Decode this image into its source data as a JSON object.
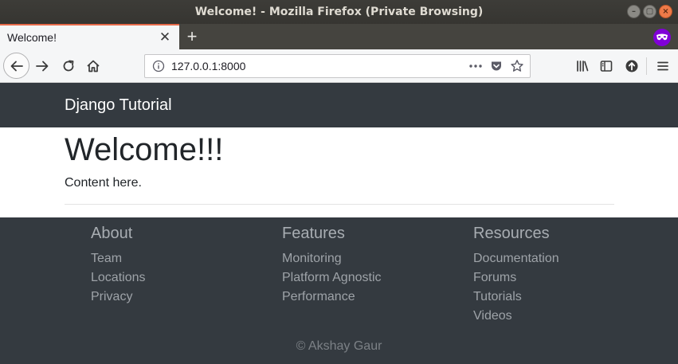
{
  "window": {
    "title": "Welcome! - Mozilla Firefox (Private Browsing)"
  },
  "tabs": [
    {
      "label": "Welcome!",
      "active": true
    }
  ],
  "toolbar": {
    "url": "127.0.0.1:8000"
  },
  "page": {
    "brand": "Django Tutorial",
    "heading": "Welcome!!!",
    "content": "Content here.",
    "footer": {
      "columns": [
        {
          "heading": "About",
          "links": [
            "Team",
            "Locations",
            "Privacy"
          ]
        },
        {
          "heading": "Features",
          "links": [
            "Monitoring",
            "Platform Agnostic",
            "Performance"
          ]
        },
        {
          "heading": "Resources",
          "links": [
            "Documentation",
            "Forums",
            "Tutorials",
            "Videos"
          ]
        }
      ],
      "copyright": "© Akshay Gaur"
    }
  },
  "icons": {
    "window_minimize": "minimize-icon",
    "window_maximize": "maximize-icon",
    "window_close": "close-icon",
    "tab_close": "close-icon",
    "new_tab": "plus-icon",
    "private_browsing": "mask-icon",
    "back": "arrow-left-icon",
    "forward": "arrow-right-icon",
    "reload": "reload-icon",
    "home": "home-icon",
    "site_info": "info-icon",
    "page_actions": "ellipsis-icon",
    "pocket": "pocket-icon",
    "bookmark": "star-icon",
    "library": "library-icon",
    "sidebar": "sidebar-icon",
    "extension": "arrow-up-circle-icon",
    "menu": "hamburger-icon"
  },
  "colors": {
    "titlebar_bg": "#3d3c38",
    "tab_accent": "#e66a4a",
    "private_badge": "#8000d7",
    "navbar_bg": "#343a40",
    "page_bg": "#ffffff",
    "text": "#212529",
    "footer_link": "#9ea3a8"
  }
}
